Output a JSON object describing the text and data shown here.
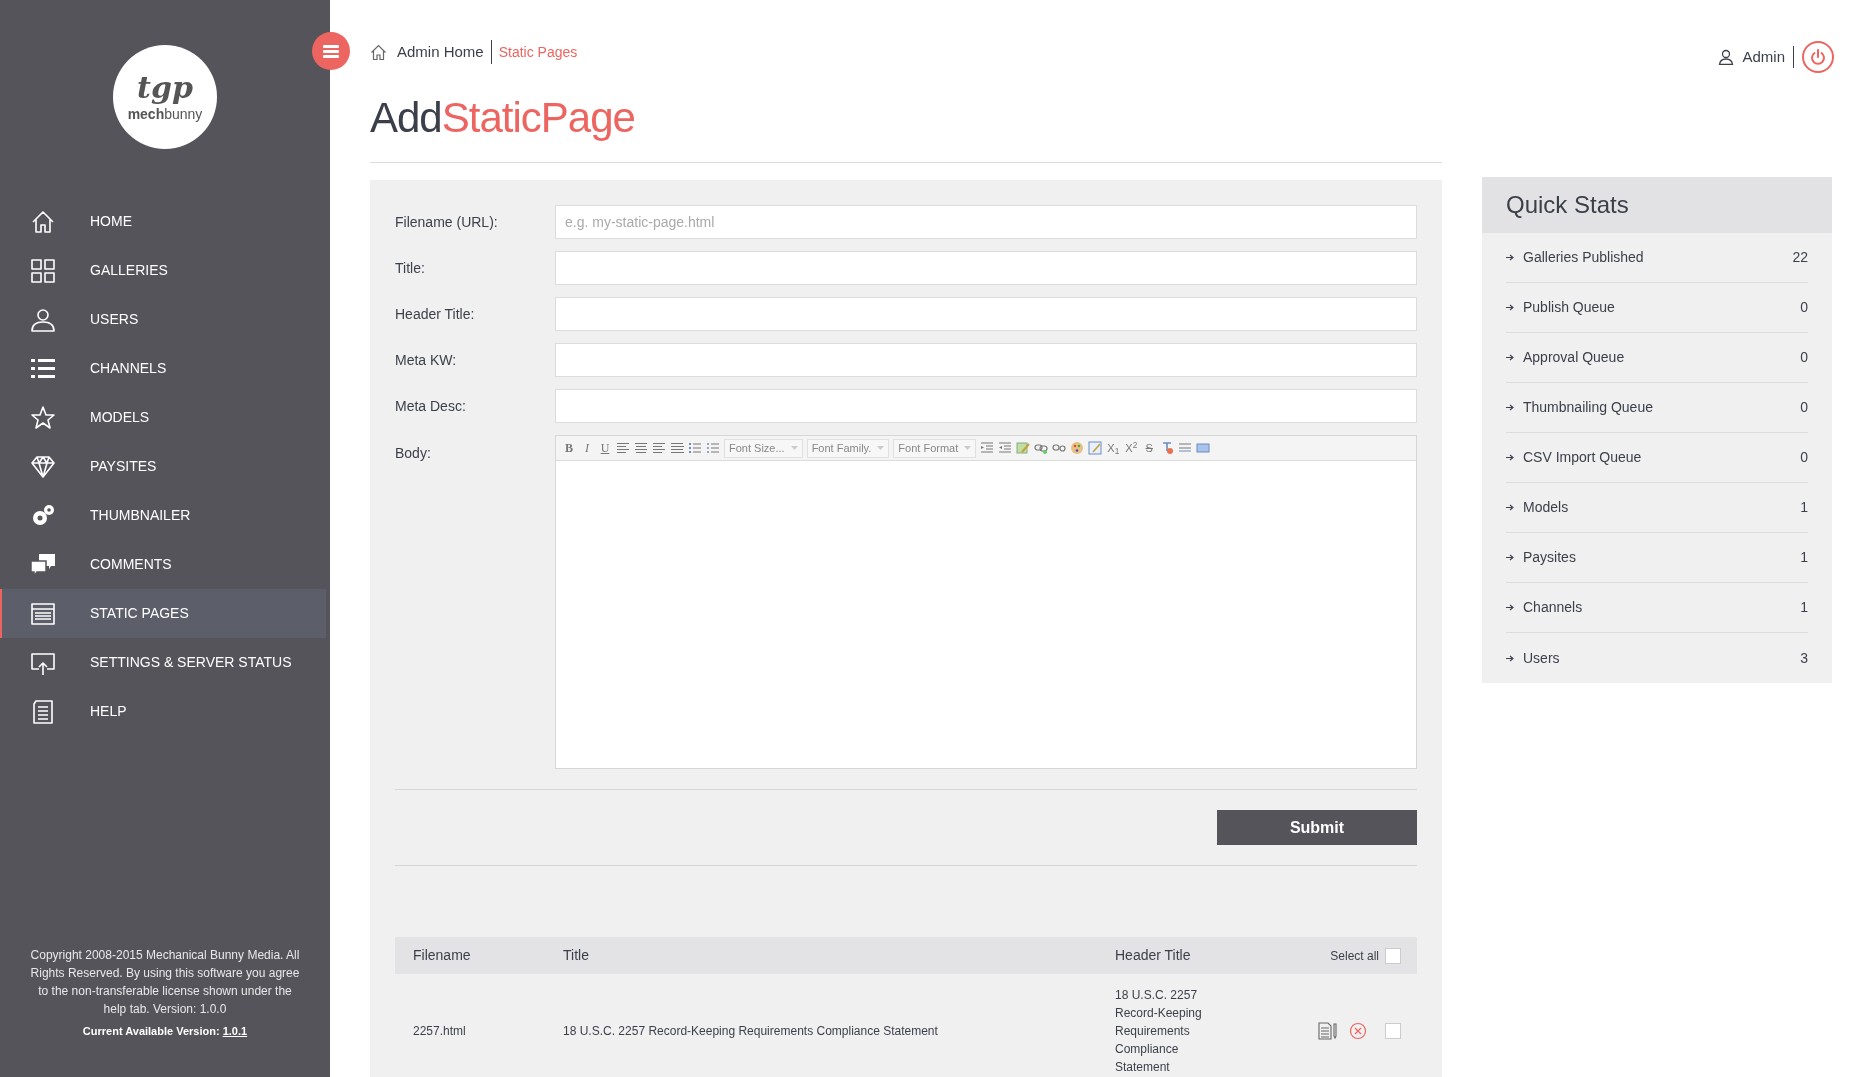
{
  "sidebar": {
    "logo": {
      "mark": "tgp",
      "wordmark_bold": "mech",
      "wordmark": "bunny"
    },
    "items": [
      {
        "label": "HOME",
        "selected": false
      },
      {
        "label": "GALLERIES",
        "selected": false
      },
      {
        "label": "USERS",
        "selected": false
      },
      {
        "label": "CHANNELS",
        "selected": false
      },
      {
        "label": "MODELS",
        "selected": false
      },
      {
        "label": "PAYSITES",
        "selected": false
      },
      {
        "label": "THUMBNAILER",
        "selected": false
      },
      {
        "label": "COMMENTS",
        "selected": false
      },
      {
        "label": "STATIC PAGES",
        "selected": true
      },
      {
        "label": "SETTINGS & SERVER STATUS",
        "selected": false
      },
      {
        "label": "HELP",
        "selected": false
      }
    ],
    "footer": {
      "text": "Copyright 2008-2015 Mechanical Bunny Media. All Rights Reserved. By using this software you agree to the non-transferable license shown under the help tab. Version: 1.0.0",
      "version_label": "Current Available Version:",
      "version_link": "1.0.1"
    }
  },
  "breadcrumb": [
    {
      "label": "Admin Home",
      "current": false
    },
    {
      "label": "Static Pages",
      "current": true
    }
  ],
  "user": {
    "name": "Admin"
  },
  "title": {
    "first": "Add",
    "second": "StaticPage"
  },
  "form": {
    "fields": [
      {
        "label": "Filename (URL):",
        "placeholder": "e.g. my-static-page.html"
      },
      {
        "label": "Title:"
      },
      {
        "label": "Header Title:"
      },
      {
        "label": "Meta KW:"
      },
      {
        "label": "Meta Desc:"
      }
    ],
    "body_label": "Body:",
    "editor": {
      "format_buttons": [
        "B",
        "I",
        "U"
      ],
      "dropdowns": [
        "Font Size...",
        "Font Family.",
        "Font Format"
      ],
      "script_buttons": [
        "X$_{1}$",
        "X$^{2}$",
        "S"
      ]
    },
    "submit": "Submit"
  },
  "table": {
    "columns": [
      "Filename",
      "Title",
      "Header Title"
    ],
    "select_all": {
      "label": "Select all",
      "checked": false
    },
    "rows": [
      {
        "filename": "2257.html",
        "title": "18 U.S.C. 2257 Record-Keeping Requirements Compliance Statement",
        "header_title": "18 U.S.C. 2257 Record-Keeping Requirements Compliance Statement",
        "checked": false
      }
    ]
  },
  "quick_stats": {
    "title": "Quick Stats",
    "items": [
      {
        "label": "Galleries Published",
        "value": "22"
      },
      {
        "label": "Publish Queue",
        "value": "0"
      },
      {
        "label": "Approval Queue",
        "value": "0"
      },
      {
        "label": "Thumbnailing Queue",
        "value": "0"
      },
      {
        "label": "CSV Import Queue",
        "value": "0"
      },
      {
        "label": "Models",
        "value": "1"
      },
      {
        "label": "Paysites",
        "value": "1"
      },
      {
        "label": "Channels",
        "value": "1"
      },
      {
        "label": "Users",
        "value": "3"
      }
    ]
  }
}
